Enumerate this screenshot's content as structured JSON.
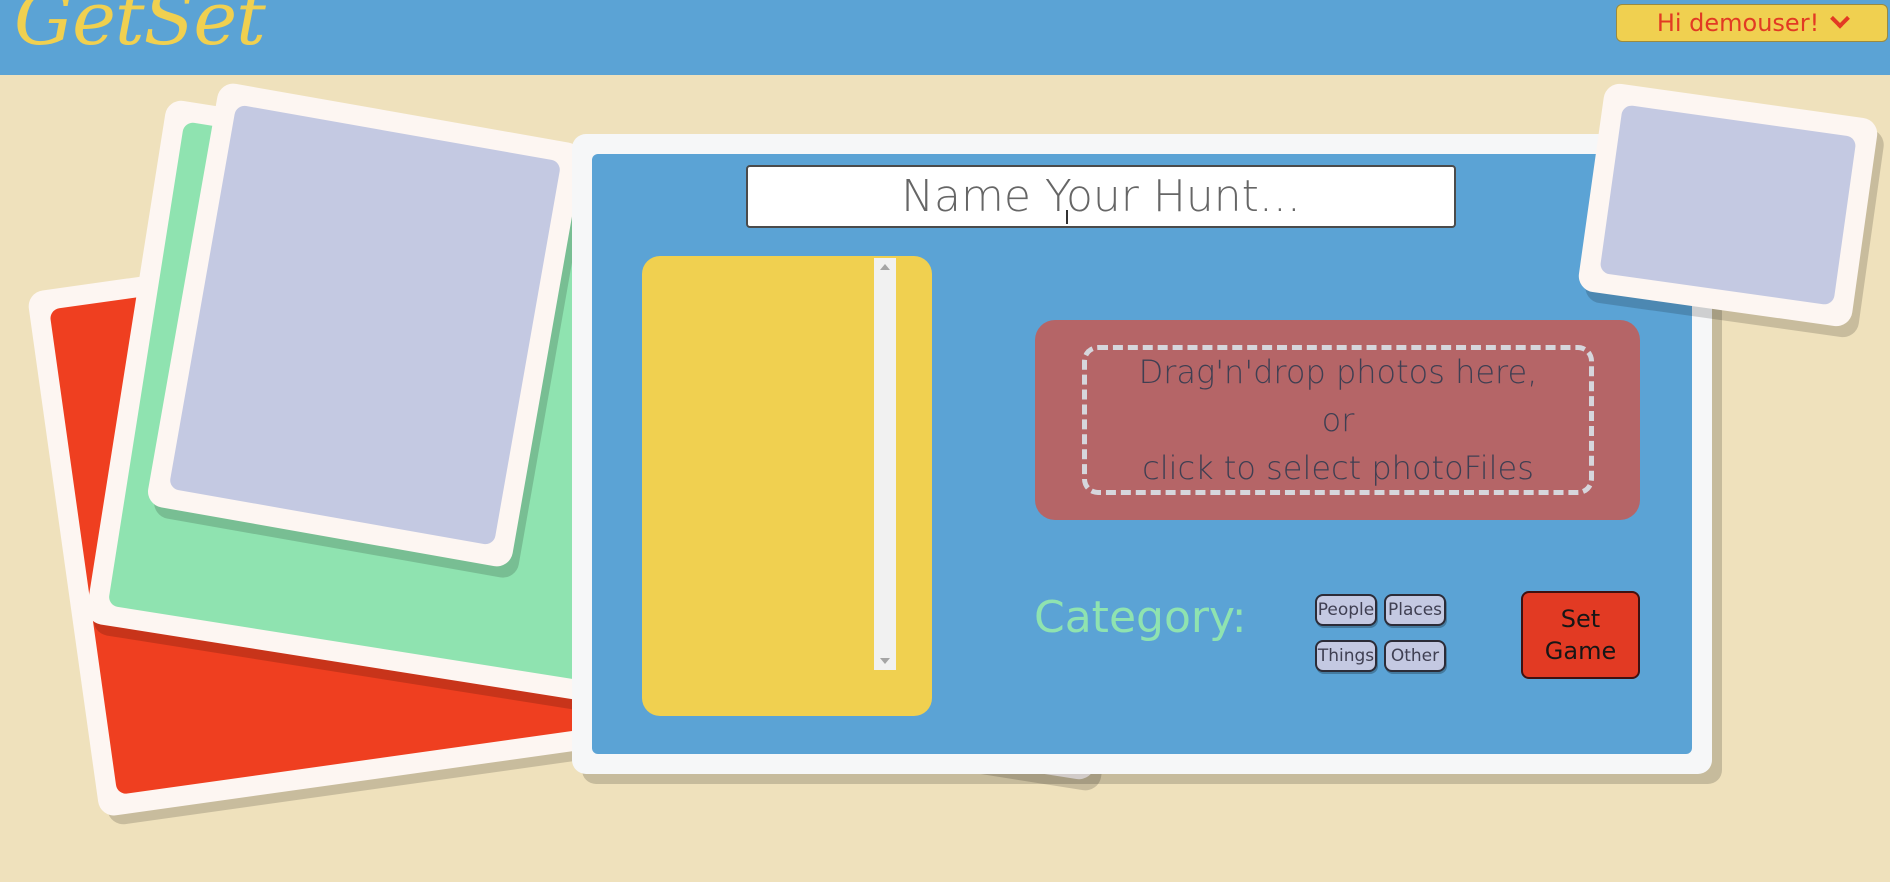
{
  "header": {
    "logo": "GetSet",
    "user_greeting": "Hi demouser!",
    "user_menu_icon": "chevron-down-icon"
  },
  "form": {
    "hunt_name_placeholder": "Name Your Hunt...",
    "dropzone_line1": "Drag'n'drop photos here, or",
    "dropzone_line2": "click to select photoFiles",
    "category_label": "Category:",
    "categories": [
      "People",
      "Places",
      "Things",
      "Other"
    ],
    "submit_line1": "Set",
    "submit_line2": "Game"
  },
  "colors": {
    "header_bg": "#5ba3d5",
    "page_bg": "#efe1bc",
    "accent_yellow": "#f0d050",
    "accent_red": "#e23a23",
    "accent_green": "#8fe3b0",
    "lavender": "#c4c9e2",
    "dropzone_bg": "#b56567"
  }
}
